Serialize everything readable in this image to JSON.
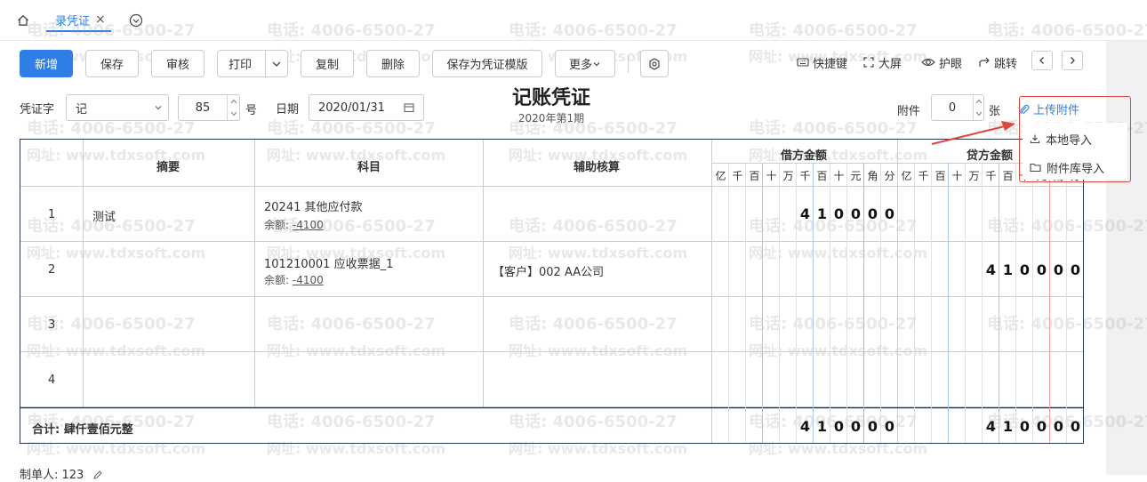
{
  "tabs": {
    "active_label": "录凭证"
  },
  "toolbar": {
    "add": "新增",
    "save": "保存",
    "audit": "审核",
    "print": "打印",
    "copy": "复制",
    "delete": "删除",
    "save_template": "保存为凭证模版",
    "more": "更多"
  },
  "tools": {
    "shortcut": "快捷键",
    "fullscreen": "大屏",
    "eye_care": "护眼",
    "jump": "跳转"
  },
  "voucher_header": {
    "word_label": "凭证字",
    "word_value": "记",
    "number_value": "85",
    "number_suffix": "号",
    "date_label": "日期",
    "date_value": "2020/01/31",
    "title": "记账凭证",
    "period": "2020年第1期",
    "attachment_label": "附件",
    "attachment_count": "0",
    "attachment_unit": "张",
    "upload_label": "上传附件"
  },
  "upload_menu": {
    "local": "本地导入",
    "library": "附件库导入"
  },
  "table": {
    "headers": {
      "summary": "摘要",
      "account": "科目",
      "auxiliary": "辅助核算",
      "debit": "借方金额",
      "credit": "贷方金额"
    },
    "units": [
      "亿",
      "千",
      "百",
      "十",
      "万",
      "千",
      "百",
      "十",
      "元",
      "角",
      "分"
    ],
    "balance_label": "余额:",
    "rows": [
      {
        "no": "1",
        "summary": "测试",
        "account": "20241  其他应付款",
        "balance": "-4100",
        "auxiliary": "",
        "debit": "410000",
        "credit": ""
      },
      {
        "no": "2",
        "summary": "",
        "account": "101210001  应收票据_1",
        "balance": "-4100",
        "auxiliary": "【客户】002 AA公司",
        "debit": "",
        "credit": "410000"
      },
      {
        "no": "3",
        "summary": "",
        "account": "",
        "balance": "",
        "auxiliary": "",
        "debit": "",
        "credit": ""
      },
      {
        "no": "4",
        "summary": "",
        "account": "",
        "balance": "",
        "auxiliary": "",
        "debit": "",
        "credit": ""
      }
    ],
    "total_label": "合计: 肆仟壹佰元整",
    "total_debit": "410000",
    "total_credit": "410000"
  },
  "footer": {
    "preparer": "制单人: 123"
  },
  "watermark": {
    "phone": "电话: 4006-6500-27",
    "url": "网址: www.tdxsoft.com"
  }
}
